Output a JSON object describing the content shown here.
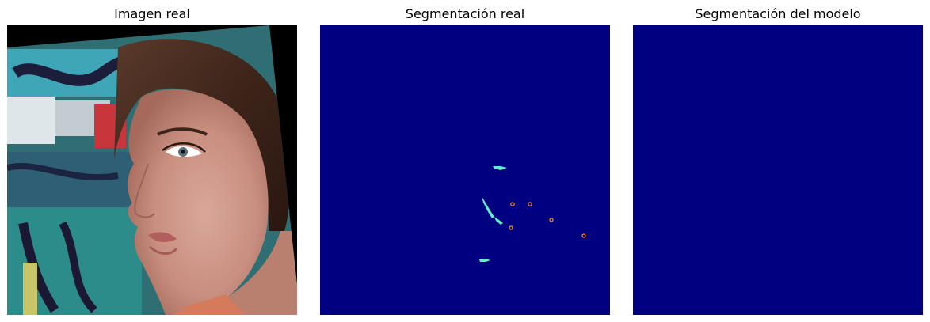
{
  "panels": [
    {
      "title": "Imagen real"
    },
    {
      "title": "Segmentación real"
    },
    {
      "title": "Segmentación del modelo"
    }
  ],
  "colors": {
    "mask_background": "#000080",
    "mask_cyan": "#60f0c8",
    "mask_orange": "#ff8c1a",
    "letterbox": "#000000"
  }
}
